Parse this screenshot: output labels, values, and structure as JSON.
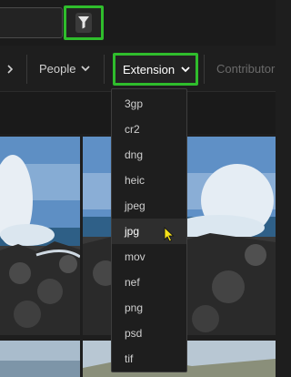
{
  "filter_bar": {
    "people_label": "People",
    "extension_label": "Extension",
    "contributor_label": "Contributor"
  },
  "extension_menu": {
    "options": [
      "3gp",
      "cr2",
      "dng",
      "heic",
      "jpeg",
      "jpg",
      "mov",
      "nef",
      "png",
      "psd",
      "tif"
    ],
    "selected": "jpg"
  },
  "icons": {
    "filter": "funnel-icon",
    "people_chevron": "chevron-down-icon",
    "extension_chevron": "chevron-down-icon",
    "nav_left": "chevron-left-icon",
    "cursor": "pointer-cursor-icon"
  },
  "colors": {
    "highlight": "#2fbd2c",
    "cursor": "#f5e11a",
    "background": "#1e1e1e"
  }
}
